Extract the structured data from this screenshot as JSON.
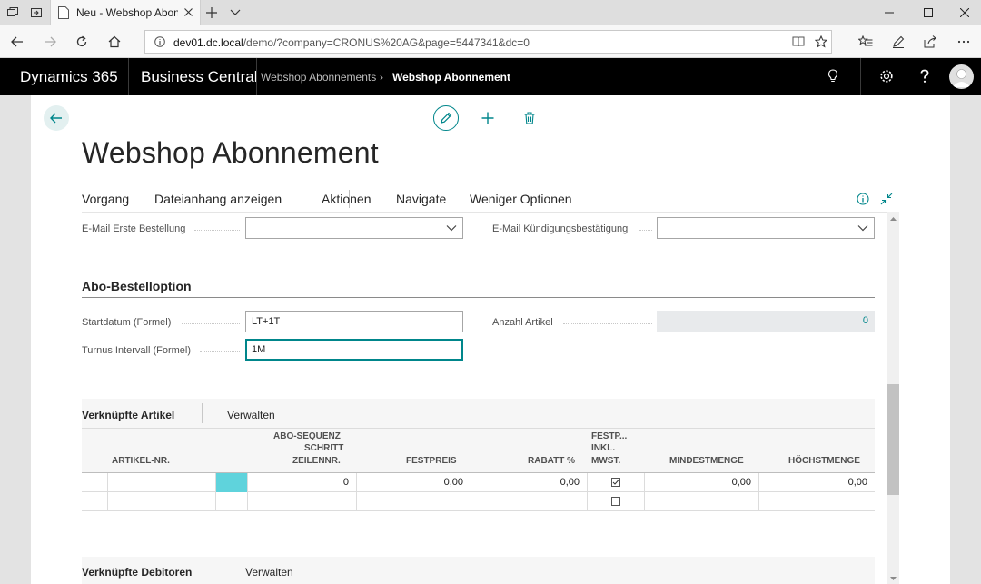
{
  "browser": {
    "tab_title": "Neu - Webshop Abonnement",
    "url_prefix": "",
    "url_host": "dev01.dc.local",
    "url_path": "/demo/?company=CRONUS%20AG&page=5447341&dc=0"
  },
  "appbar": {
    "product": "Dynamics 365",
    "app": "Business Central",
    "breadcrumb": [
      "Webshop Abonnements",
      "Webshop Abonnement"
    ]
  },
  "page": {
    "title": "Webshop Abonnement",
    "menu": [
      "Vorgang",
      "Dateianhang anzeigen",
      "Aktionen",
      "Navigate",
      "Weniger Optionen"
    ]
  },
  "fields": {
    "email_first_order_label": "E-Mail Erste Bestellung",
    "email_first_order_value": "",
    "email_cancel_label": "E-Mail Kündigungsbestätigung",
    "email_cancel_value": "",
    "section_title": "Abo-Bestelloption",
    "start_date_label": "Startdatum (Formel)",
    "start_date_value": "LT+1T",
    "interval_label": "Turnus Intervall (Formel)",
    "interval_value": "1M",
    "item_count_label": "Anzahl Artikel",
    "item_count_value": "0"
  },
  "linked_items": {
    "title": "Verknüpfte Artikel",
    "action": "Verwalten",
    "columns": {
      "item_no": "ARTIKEL-NR.",
      "seq_1": "ABO-SEQUENZ",
      "seq_2": "SCHRITT",
      "seq_3": "ZEILENNR.",
      "fixed_price": "FESTPREIS",
      "discount": "RABATT %",
      "fp_incl_1": "FESTP...",
      "fp_incl_2": "INKL.",
      "fp_incl_3": "MWST.",
      "min_qty": "MINDESTMENGE",
      "max_qty": "HÖCHSTMENGE"
    },
    "rows": [
      {
        "seq": "0",
        "fixed_price": "0,00",
        "discount": "0,00",
        "incl_vat": true,
        "min_qty": "0,00",
        "max_qty": "0,00"
      },
      {
        "seq": "",
        "fixed_price": "",
        "discount": "",
        "incl_vat": false,
        "min_qty": "",
        "max_qty": ""
      }
    ]
  },
  "linked_customers": {
    "title": "Verknüpfte Debitoren",
    "action": "Verwalten"
  },
  "colors": {
    "accent": "#00868b",
    "selected_cell": "#5fd3dc",
    "appbar": "#000000"
  },
  "icons": [
    "back-arrow-icon",
    "pencil-icon",
    "plus-icon",
    "trash-icon",
    "info-icon",
    "collapse-icon",
    "lightbulb-icon",
    "gear-icon",
    "help-icon",
    "user-avatar-icon"
  ]
}
